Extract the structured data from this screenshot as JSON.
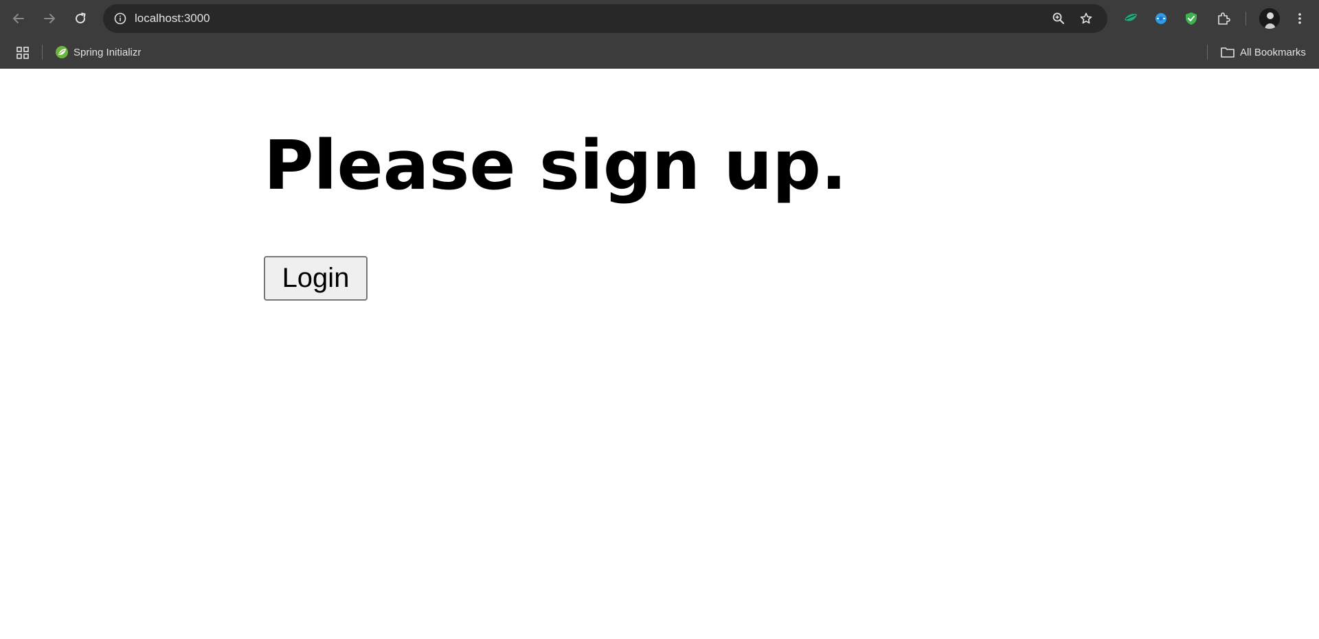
{
  "browser": {
    "address_bar": {
      "url": "localhost:3000"
    },
    "bookmarks": {
      "items": [
        {
          "label": "Spring Initializr",
          "icon": "spring-leaf-icon"
        }
      ],
      "all_bookmarks_label": "All Bookmarks"
    },
    "icons": {
      "back": "back-arrow-icon",
      "forward": "forward-arrow-icon",
      "reload": "reload-icon",
      "site_info": "info-icon",
      "zoom": "zoom-in-icon",
      "bookmark_star": "star-icon",
      "menu": "kebab-menu-icon"
    },
    "colors": {
      "toolbar": "#3c3c3c",
      "omnibox": "#282828",
      "text": "#e3e3e3"
    }
  },
  "page": {
    "heading": "Please sign up.",
    "login_button": "Login"
  }
}
